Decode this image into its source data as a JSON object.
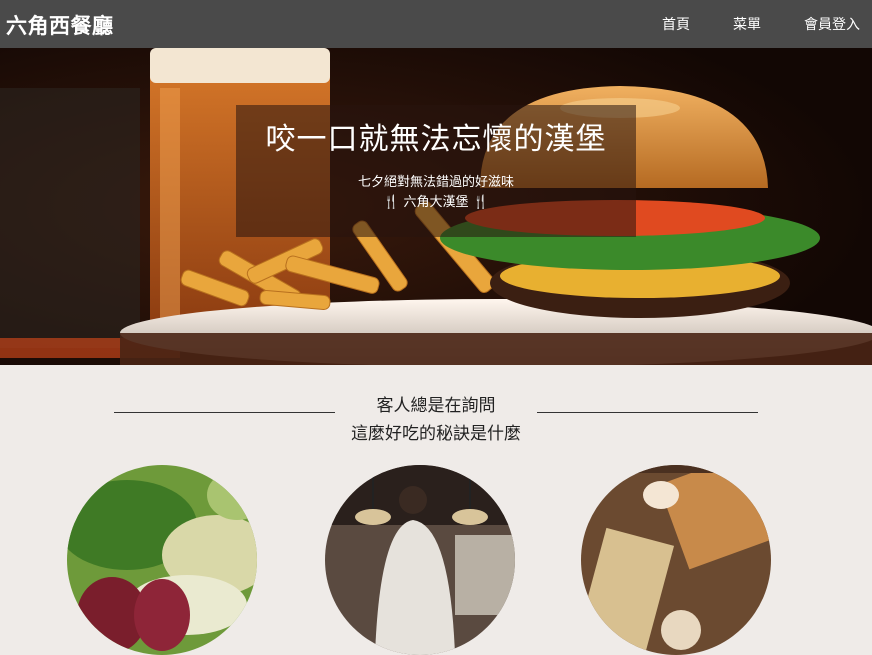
{
  "header": {
    "brand": "六角西餐廳",
    "nav": [
      {
        "label": "首頁"
      },
      {
        "label": "菜單"
      },
      {
        "label": "會員登入"
      }
    ]
  },
  "hero": {
    "title": "咬一口就無法忘懷的漢堡",
    "subtitle": "七夕絕對無法錯過的好滋味",
    "tagline": "六角大漢堡",
    "icon": "fork-knife-icon"
  },
  "section": {
    "heading_line1": "客人總是在詢問",
    "heading_line2": "這麼好吃的秘訣是什麼",
    "images": [
      {
        "name": "fresh-vegetables-image"
      },
      {
        "name": "chef-kitchen-image"
      },
      {
        "name": "baking-ingredients-image"
      }
    ]
  }
}
